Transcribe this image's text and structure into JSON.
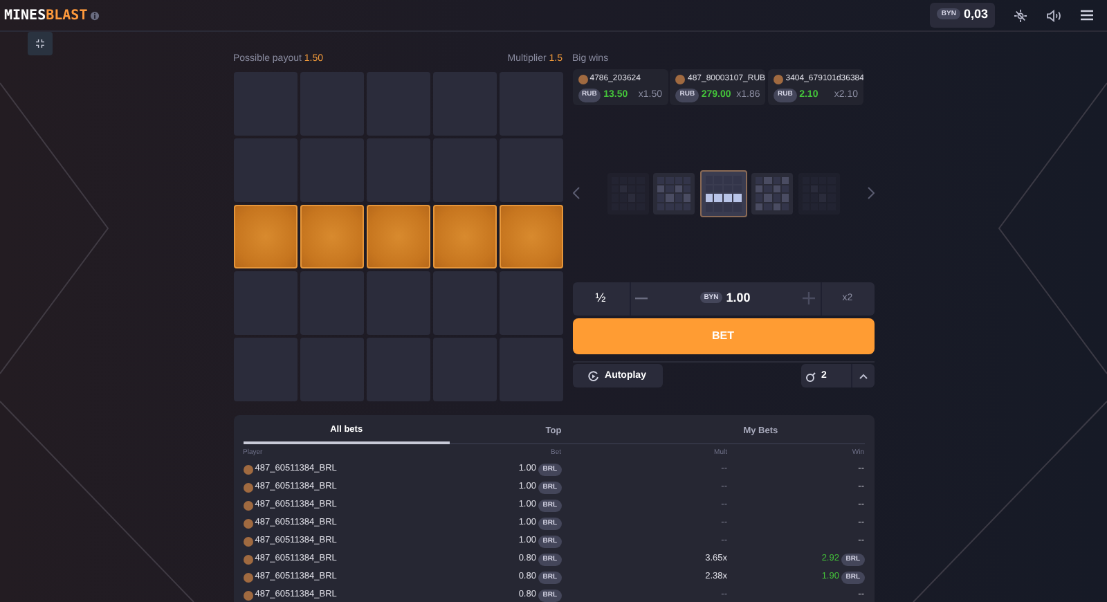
{
  "header": {
    "logo_part1": "MINES",
    "logo_part2": "BLAST",
    "balance_currency": "BYN",
    "balance": "0,03"
  },
  "board": {
    "payout_label": "Possible payout",
    "payout": "1.50",
    "multiplier_label": "Multiplier",
    "multiplier": "1.5",
    "tiles": [
      {
        "revealed": false
      },
      {
        "revealed": false
      },
      {
        "revealed": false
      },
      {
        "revealed": false
      },
      {
        "revealed": false
      },
      {
        "revealed": false
      },
      {
        "revealed": false
      },
      {
        "revealed": false
      },
      {
        "revealed": false
      },
      {
        "revealed": false
      },
      {
        "revealed": true
      },
      {
        "revealed": true
      },
      {
        "revealed": true
      },
      {
        "revealed": true
      },
      {
        "revealed": true
      },
      {
        "revealed": false
      },
      {
        "revealed": false
      },
      {
        "revealed": false
      },
      {
        "revealed": false
      },
      {
        "revealed": false
      },
      {
        "revealed": false
      },
      {
        "revealed": false
      },
      {
        "revealed": false
      },
      {
        "revealed": false
      },
      {
        "revealed": false
      }
    ]
  },
  "big_wins": {
    "title": "Big wins",
    "items": [
      {
        "player": "4786_203624",
        "currency": "RUB",
        "amount": "13.50",
        "mult": "x1.50"
      },
      {
        "player": "487_80003107_RUB",
        "currency": "RUB",
        "amount": "279.00",
        "mult": "x1.86"
      },
      {
        "player": "3404_679101d36384",
        "currency": "RUB",
        "amount": "2.10",
        "mult": "x2.10"
      }
    ]
  },
  "patterns": [
    {
      "kind": "faded",
      "selected": false
    },
    {
      "kind": "dots",
      "selected": false
    },
    {
      "kind": "row",
      "selected": true
    },
    {
      "kind": "checker",
      "selected": false
    },
    {
      "kind": "faded",
      "selected": false
    }
  ],
  "bet": {
    "half": "½",
    "currency": "BYN",
    "amount": "1.00",
    "double": "x2",
    "button": "BET",
    "autoplay": "Autoplay",
    "mines": "2"
  },
  "bets": {
    "tabs": [
      {
        "label": "All bets",
        "selected": true
      },
      {
        "label": "Top",
        "selected": false
      },
      {
        "label": "My Bets",
        "selected": false
      }
    ],
    "columns": [
      "Player",
      "Bet",
      "Mult",
      "Win"
    ],
    "rows": [
      {
        "player": "487_60511384_BRL",
        "bet": "1.00",
        "currency": "BRL",
        "mult": "--",
        "win": "--",
        "win_currency": ""
      },
      {
        "player": "487_60511384_BRL",
        "bet": "1.00",
        "currency": "BRL",
        "mult": "--",
        "win": "--",
        "win_currency": ""
      },
      {
        "player": "487_60511384_BRL",
        "bet": "1.00",
        "currency": "BRL",
        "mult": "--",
        "win": "--",
        "win_currency": ""
      },
      {
        "player": "487_60511384_BRL",
        "bet": "1.00",
        "currency": "BRL",
        "mult": "--",
        "win": "--",
        "win_currency": ""
      },
      {
        "player": "487_60511384_BRL",
        "bet": "1.00",
        "currency": "BRL",
        "mult": "--",
        "win": "--",
        "win_currency": ""
      },
      {
        "player": "487_60511384_BRL",
        "bet": "0.80",
        "currency": "BRL",
        "mult": "3.65x",
        "win": "2.92",
        "win_currency": "BRL"
      },
      {
        "player": "487_60511384_BRL",
        "bet": "0.80",
        "currency": "BRL",
        "mult": "2.38x",
        "win": "1.90",
        "win_currency": "BRL"
      },
      {
        "player": "487_60511384_BRL",
        "bet": "0.80",
        "currency": "BRL",
        "mult": "--",
        "win": "--",
        "win_currency": ""
      }
    ]
  }
}
